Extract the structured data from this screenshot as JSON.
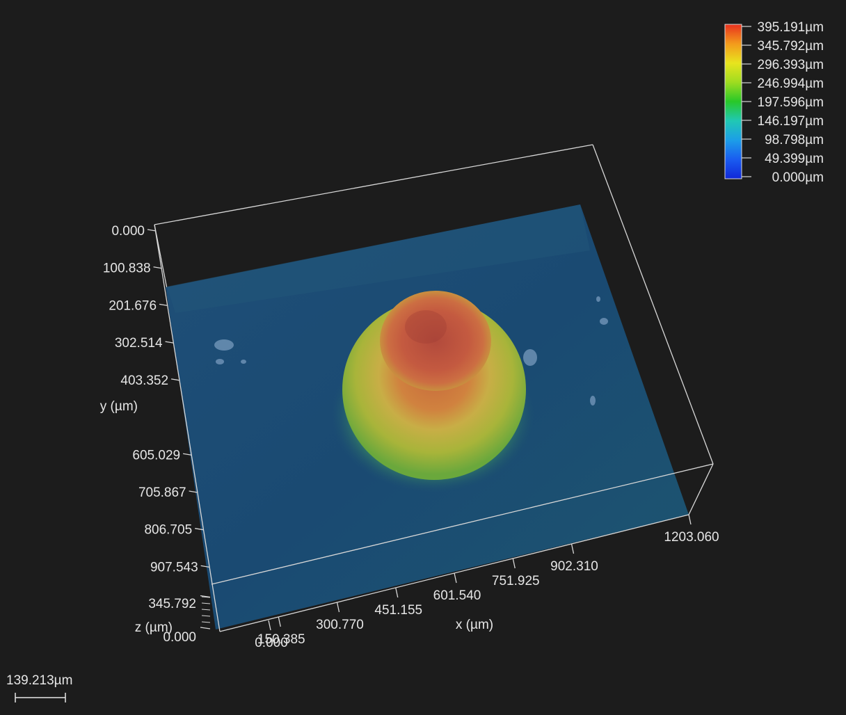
{
  "chart_data": {
    "type": "heatmap",
    "title": "",
    "x_axis": {
      "label": "x (µm)",
      "ticks": [
        "0.000",
        "150.385",
        "300.770",
        "451.155",
        "601.540",
        "751.925",
        "902.310",
        "1203.060"
      ],
      "range": [
        0,
        1203.06
      ]
    },
    "y_axis": {
      "label": "y (µm)",
      "ticks": [
        "0.000",
        "100.838",
        "201.676",
        "302.514",
        "403.352",
        "605.029",
        "705.867",
        "806.705",
        "907.543"
      ],
      "range": [
        0,
        907.543
      ]
    },
    "z_axis": {
      "label": "z (µm)",
      "ticks": [
        "345.792",
        "0.000"
      ],
      "range": [
        0,
        395.191
      ]
    },
    "color_scale": {
      "labels": [
        "395.191µm",
        "345.792µm",
        "296.393µm",
        "246.994µm",
        "197.596µm",
        "146.197µm",
        "98.798µm",
        "49.399µm",
        "0.000µm"
      ],
      "values": [
        395.191,
        345.792,
        296.393,
        246.994,
        197.596,
        146.197,
        98.798,
        49.399,
        0.0
      ],
      "colors": [
        "#e8301e",
        "#f39a1c",
        "#e8e41e",
        "#9fdc20",
        "#28c828",
        "#20c8b4",
        "#1c9ee8",
        "#1a5cf0",
        "#1028d8"
      ]
    },
    "feature": {
      "shape": "dome",
      "peak_height": 395.191,
      "base_height": 49.399
    },
    "scale_bar": "139.213µm"
  }
}
